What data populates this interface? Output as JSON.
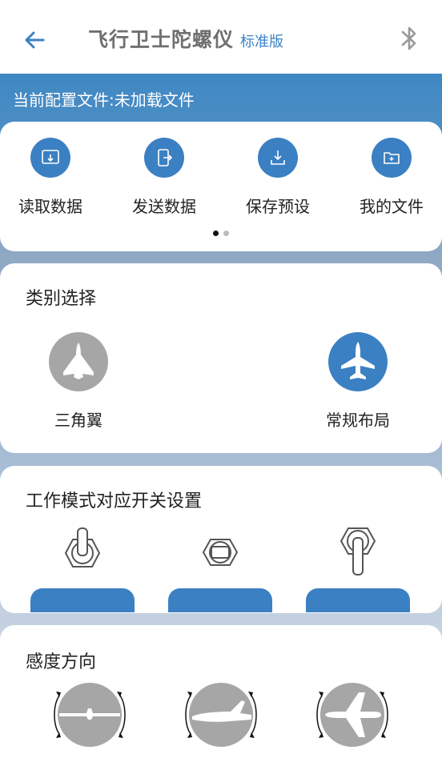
{
  "header": {
    "title": "飞行卫士陀螺仪",
    "edition": "标准版"
  },
  "config": {
    "text": "当前配置文件:未加载文件"
  },
  "actions": [
    {
      "label": "读取数据",
      "icon": "read-data-icon"
    },
    {
      "label": "发送数据",
      "icon": "send-data-icon"
    },
    {
      "label": "保存预设",
      "icon": "save-preset-icon"
    },
    {
      "label": "我的文件",
      "icon": "my-files-icon"
    }
  ],
  "pager": {
    "pages": 2,
    "active": 0
  },
  "category": {
    "title": "类别选择",
    "items": [
      {
        "label": "三角翼",
        "icon": "delta-wing-jet-icon",
        "selected": false
      },
      {
        "label": "常规布局",
        "icon": "conventional-jet-icon",
        "selected": true
      }
    ]
  },
  "mode": {
    "title": "工作模式对应开关设置",
    "switches": [
      {
        "icon": "toggle-switch-up-icon"
      },
      {
        "icon": "toggle-switch-middle-icon"
      },
      {
        "icon": "toggle-switch-down-icon"
      }
    ]
  },
  "sensitivity": {
    "title": "感度方向",
    "items": [
      {
        "icon": "roll-direction-icon"
      },
      {
        "icon": "pitch-direction-icon"
      },
      {
        "icon": "yaw-direction-icon"
      }
    ]
  },
  "colors": {
    "accent": "#3b80c3",
    "inactive": "#a6a6a6",
    "title_gray": "#6f6f6f"
  }
}
